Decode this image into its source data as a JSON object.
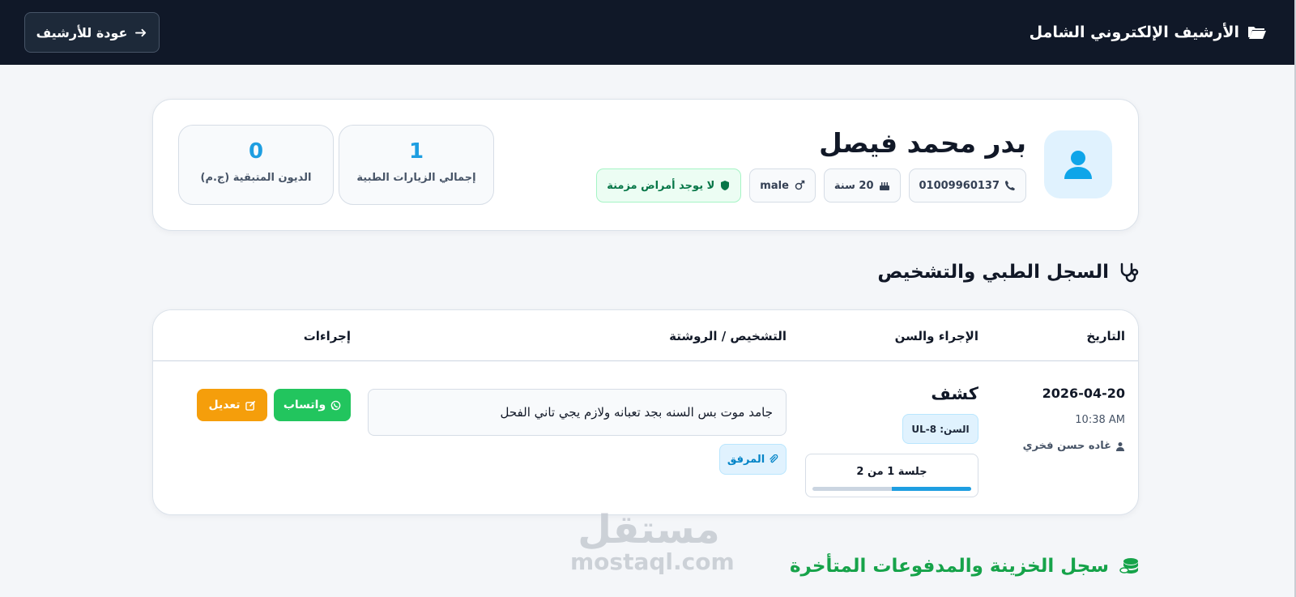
{
  "header": {
    "brand_title": "الأرشيف الإلكتروني الشامل",
    "brand_icon": "folder-open-icon",
    "back_label": "عودة للأرشيف",
    "back_icon": "arrow-right-icon"
  },
  "patient": {
    "name": "بدر محمد فيصل",
    "avatar_icon": "user-icon",
    "phone": "01009960137",
    "age": "20 سنة",
    "gender": "male",
    "chronic_status": "لا يوجد أمراض مزمنة"
  },
  "stats": [
    {
      "value": "1",
      "label": "إجمالي الزيارات الطبية"
    },
    {
      "value": "0",
      "label": "الديون المتبقية (ج.م)"
    }
  ],
  "medical_section": {
    "title": "السجل الطبي والتشخيص",
    "icon": "stethoscope-icon",
    "columns": {
      "date": "التاريخ",
      "procedure": "الإجراء والسن",
      "diagnosis": "التشخيص / الروشتة",
      "actions": "إجراءات"
    },
    "records": [
      {
        "date": "2026-04-20",
        "time": "10:38 AM",
        "doctor": "غاده حسن فخري",
        "procedure": "كشف",
        "tooth": "السن: UL-8",
        "session_label": "جلسة 1 من 2",
        "session_progress": 0.5,
        "diagnosis": "جامد موت بس السنه بجد تعبانه ولازم يجي تاني الفحل",
        "attachment_label": "المرفق",
        "whatsapp_label": "واتساب",
        "edit_label": "تعديل"
      }
    ]
  },
  "treasury_section": {
    "title": "سجل الخزينة والمدفوعات المتأخرة",
    "icon": "coins-icon"
  },
  "watermark": {
    "ar": "مستقل",
    "en": "mostaql.com"
  },
  "colors": {
    "topbar": "#101828",
    "accent_blue": "#1e9ee1",
    "green": "#22c55e",
    "orange": "#f59e0b"
  }
}
